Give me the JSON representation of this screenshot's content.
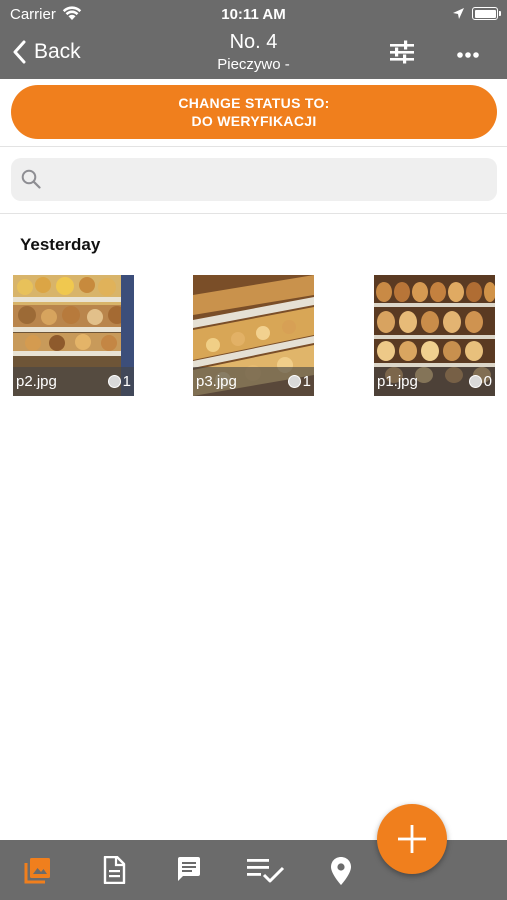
{
  "status_bar": {
    "carrier": "Carrier",
    "time": "10:11 AM"
  },
  "nav": {
    "back_label": "Back",
    "title": "No. 4",
    "subtitle": "Pieczywo -"
  },
  "status_button": {
    "line1": "CHANGE STATUS TO:",
    "line2": "DO WERYFIKACJI"
  },
  "search": {
    "placeholder": "",
    "value": ""
  },
  "section": {
    "title": "Yesterday"
  },
  "photos": [
    {
      "name": "p2.jpg",
      "count": "1"
    },
    {
      "name": "p3.jpg",
      "count": "1"
    },
    {
      "name": "p1.jpg",
      "count": "0"
    }
  ],
  "tabs": [
    "photos-icon",
    "document-icon",
    "comments-icon",
    "checklist-icon",
    "location-icon"
  ],
  "colors": {
    "accent": "#f07f1d",
    "bar": "#6b6b6b",
    "active_tab": "#f07f1d"
  }
}
